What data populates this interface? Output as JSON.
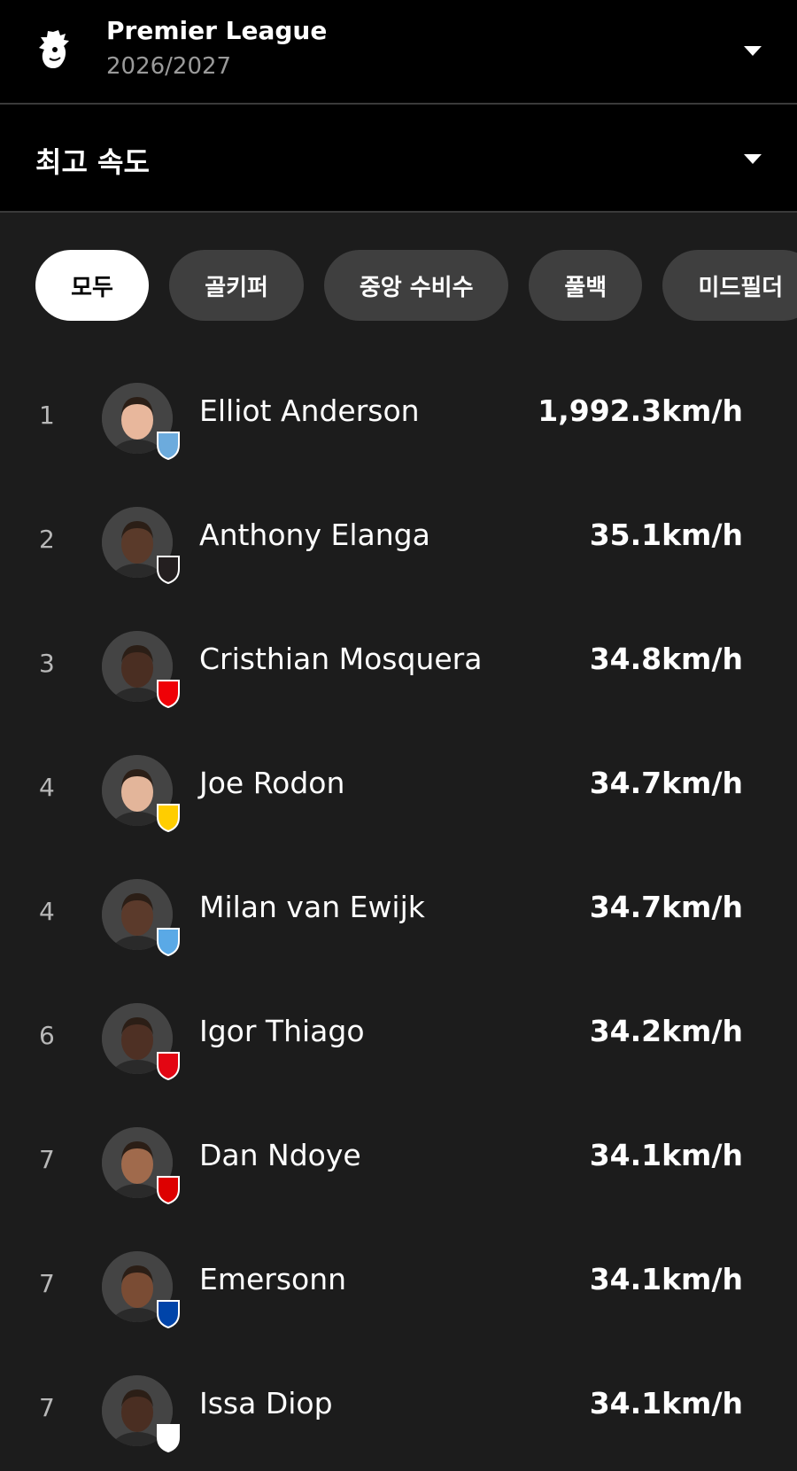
{
  "league": {
    "name": "Premier League",
    "season": "2026/2027",
    "logo_icon": "lion-crest-icon"
  },
  "stat": {
    "title": "최고 속도"
  },
  "filters": [
    {
      "label": "모두",
      "active": true
    },
    {
      "label": "골키퍼",
      "active": false
    },
    {
      "label": "중앙 수비수",
      "active": false
    },
    {
      "label": "풀백",
      "active": false
    },
    {
      "label": "미드필더",
      "active": false
    }
  ],
  "players": [
    {
      "rank": "1",
      "name": "Elliot Anderson",
      "value": "1,992.3km/h",
      "club_badge": "man-city-badge",
      "badge_color": "#6cabdd",
      "skin": "#e8b79c"
    },
    {
      "rank": "2",
      "name": "Anthony Elanga",
      "value": "35.1km/h",
      "club_badge": "newcastle-badge",
      "badge_color": "#241f20",
      "skin": "#5a3a2a"
    },
    {
      "rank": "3",
      "name": "Cristhian Mosquera",
      "value": "34.8km/h",
      "club_badge": "arsenal-badge",
      "badge_color": "#ef0107",
      "skin": "#4a2e22"
    },
    {
      "rank": "4",
      "name": "Joe Rodon",
      "value": "34.7km/h",
      "club_badge": "leeds-badge",
      "badge_color": "#ffcd00",
      "skin": "#e3b59a"
    },
    {
      "rank": "4",
      "name": "Milan van Ewijk",
      "value": "34.7km/h",
      "club_badge": "coventry-badge",
      "badge_color": "#5aa9e6",
      "skin": "#5b3a2b"
    },
    {
      "rank": "6",
      "name": "Igor Thiago",
      "value": "34.2km/h",
      "club_badge": "brentford-badge",
      "badge_color": "#e30613",
      "skin": "#4e3024"
    },
    {
      "rank": "7",
      "name": "Dan Ndoye",
      "value": "34.1km/h",
      "club_badge": "nottingham-forest-badge",
      "badge_color": "#dd0000",
      "skin": "#a06a4c"
    },
    {
      "rank": "7",
      "name": "Emersonn",
      "value": "34.1km/h",
      "club_badge": "ipswich-badge",
      "badge_color": "#0044a9",
      "skin": "#7a4c34"
    },
    {
      "rank": "7",
      "name": "Issa Diop",
      "value": "34.1km/h",
      "club_badge": "fulham-badge",
      "badge_color": "#ffffff",
      "skin": "#4a2e22"
    }
  ]
}
